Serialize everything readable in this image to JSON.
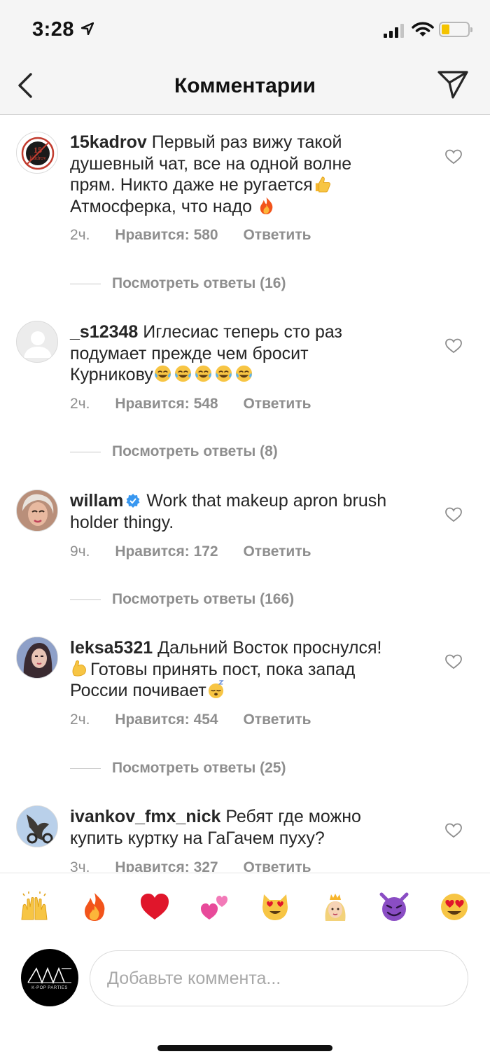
{
  "status_bar": {
    "time": "3:28"
  },
  "nav": {
    "title": "Комментарии",
    "back_icon": "chevron-left-icon",
    "send_icon": "paper-plane-icon"
  },
  "comments": [
    {
      "username": "15kadrov",
      "avatar_label": "15 Kadrov",
      "text_lines": [
        "Первый раз вижу такой",
        "душевный чат, все на одной волне",
        "прям. Никто даже не ругается",
        "Атмосферка, что надо "
      ],
      "time": "2ч.",
      "likes": "Нравится: 580",
      "reply": "Ответить",
      "view_replies": "Посмотреть ответы (16)"
    },
    {
      "username": "_s12348",
      "text_lines": [
        "Иглесиас теперь сто раз",
        "подумает прежде чем бросит",
        "Курникову"
      ],
      "time": "2ч.",
      "likes": "Нравится: 548",
      "reply": "Ответить",
      "view_replies": "Посмотреть ответы (8)"
    },
    {
      "username": "willam",
      "verified": true,
      "text_lines": [
        "Work that makeup apron brush",
        "holder thingy."
      ],
      "time": "9ч.",
      "likes": "Нравится: 172",
      "reply": "Ответить",
      "view_replies": "Посмотреть ответы (166)"
    },
    {
      "username": "leksa5321",
      "text_lines": [
        "Дальний Восток проснулся!",
        "Готовы принять пост, пока запад",
        "России почивает"
      ],
      "time": "2ч.",
      "likes": "Нравится: 454",
      "reply": "Ответить",
      "view_replies": "Посмотреть ответы (25)"
    },
    {
      "username": "ivankov_fmx_nick",
      "text_lines": [
        "Ребят где можно",
        "купить куртку на ГаГачем пуху?"
      ],
      "time": "3ч.",
      "likes": "Нравится: 327",
      "reply": "Ответить"
    }
  ],
  "quick_emojis": [
    "raising-hands-emoji",
    "fire-emoji",
    "red-heart-emoji",
    "two-hearts-emoji",
    "heart-eyes-cat-emoji",
    "princess-emoji",
    "smiling-devil-emoji",
    "heart-eyes-emoji"
  ],
  "composer": {
    "placeholder": "Добавьте коммента...",
    "avatar_label": "K-POP PARTIES"
  },
  "colors": {
    "bar_bg": "#f5f5f5",
    "muted": "#8e8e8e",
    "text": "#262626",
    "verified": "#3897f0"
  }
}
